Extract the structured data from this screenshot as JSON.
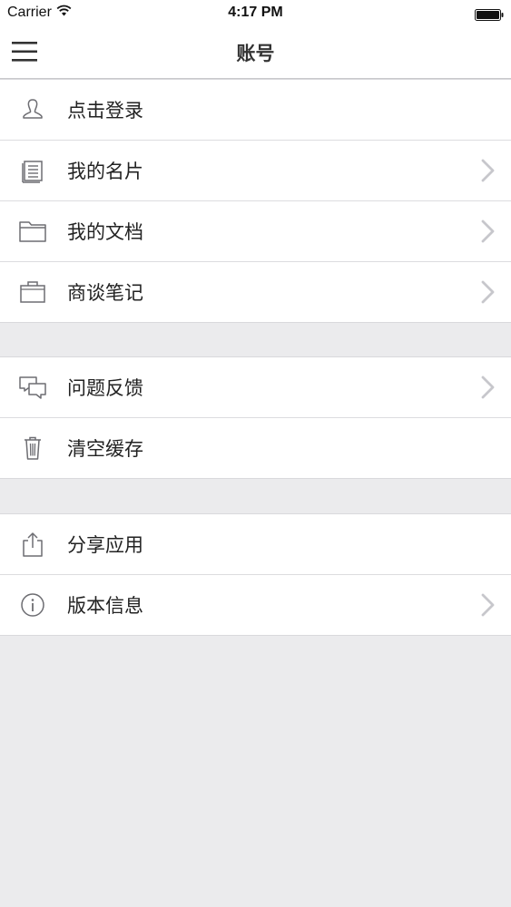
{
  "status_bar": {
    "carrier": "Carrier",
    "time": "4:17 PM"
  },
  "nav": {
    "title": "账号",
    "menu_icon": "hamburger-menu-icon"
  },
  "groups": [
    {
      "items": [
        {
          "label": "点击登录",
          "icon": "user-icon",
          "chevron": false
        },
        {
          "label": "我的名片",
          "icon": "card-icon",
          "chevron": true
        },
        {
          "label": "我的文档",
          "icon": "folder-icon",
          "chevron": true
        },
        {
          "label": "商谈笔记",
          "icon": "briefcase-icon",
          "chevron": true
        }
      ]
    },
    {
      "items": [
        {
          "label": "问题反馈",
          "icon": "chat-bubbles-icon",
          "chevron": true
        },
        {
          "label": "清空缓存",
          "icon": "trash-icon",
          "chevron": false
        }
      ]
    },
    {
      "items": [
        {
          "label": "分享应用",
          "icon": "share-icon",
          "chevron": false
        },
        {
          "label": "版本信息",
          "icon": "info-icon",
          "chevron": true
        }
      ]
    }
  ],
  "colors": {
    "background": "#ebebed",
    "row_background": "#ffffff",
    "separator": "#dcdcdf",
    "icon_stroke": "#6d6d72",
    "chevron": "#c7c7cc",
    "label_text": "#222222"
  }
}
